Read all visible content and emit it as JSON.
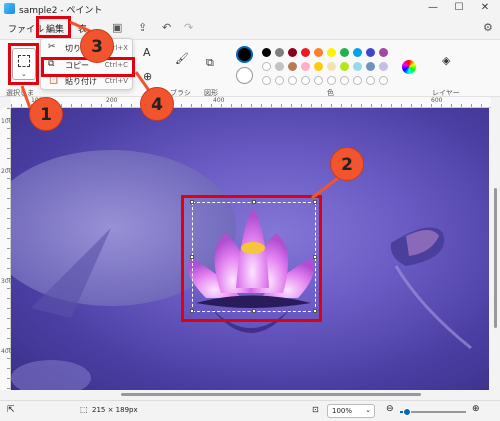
{
  "window": {
    "title": "sample2 - ペイント"
  },
  "menu": {
    "file": "ファイル",
    "edit": "編集",
    "view": "表"
  },
  "edit_menu": {
    "cut": {
      "label": "切り取り",
      "shortcut": "Ctrl+X"
    },
    "copy": {
      "label": "コピー",
      "shortcut": "Ctrl+C"
    },
    "paste": {
      "label": "貼り付け",
      "shortcut": "Ctrl+V"
    }
  },
  "ribbon": {
    "selection_label": "選択しま",
    "brush_label": "ブラシ",
    "shapes_label": "図形",
    "colors_label": "色",
    "layers_label": "レイヤー"
  },
  "ruler": {
    "h": [
      "100",
      "200",
      "400",
      "600"
    ],
    "v": [
      "100",
      "200",
      "300",
      "400"
    ]
  },
  "colors": {
    "row1": [
      "#000000",
      "#7f7f7f",
      "#880015",
      "#ed1c24",
      "#ff7f27",
      "#fff200",
      "#22b14c",
      "#00a2e8",
      "#3f48cc",
      "#a349a4"
    ],
    "row2": [
      "#ffffff",
      "#c3c3c3",
      "#b97a57",
      "#ffaec9",
      "#ffc90e",
      "#efe4b0",
      "#b5e61d",
      "#99d9ea",
      "#7092be",
      "#c8bfe7"
    ]
  },
  "status": {
    "selection_size": "215 × 189px",
    "zoom": "100%"
  },
  "zoom_level": 0.1,
  "callouts": [
    "1",
    "2",
    "3",
    "4"
  ]
}
